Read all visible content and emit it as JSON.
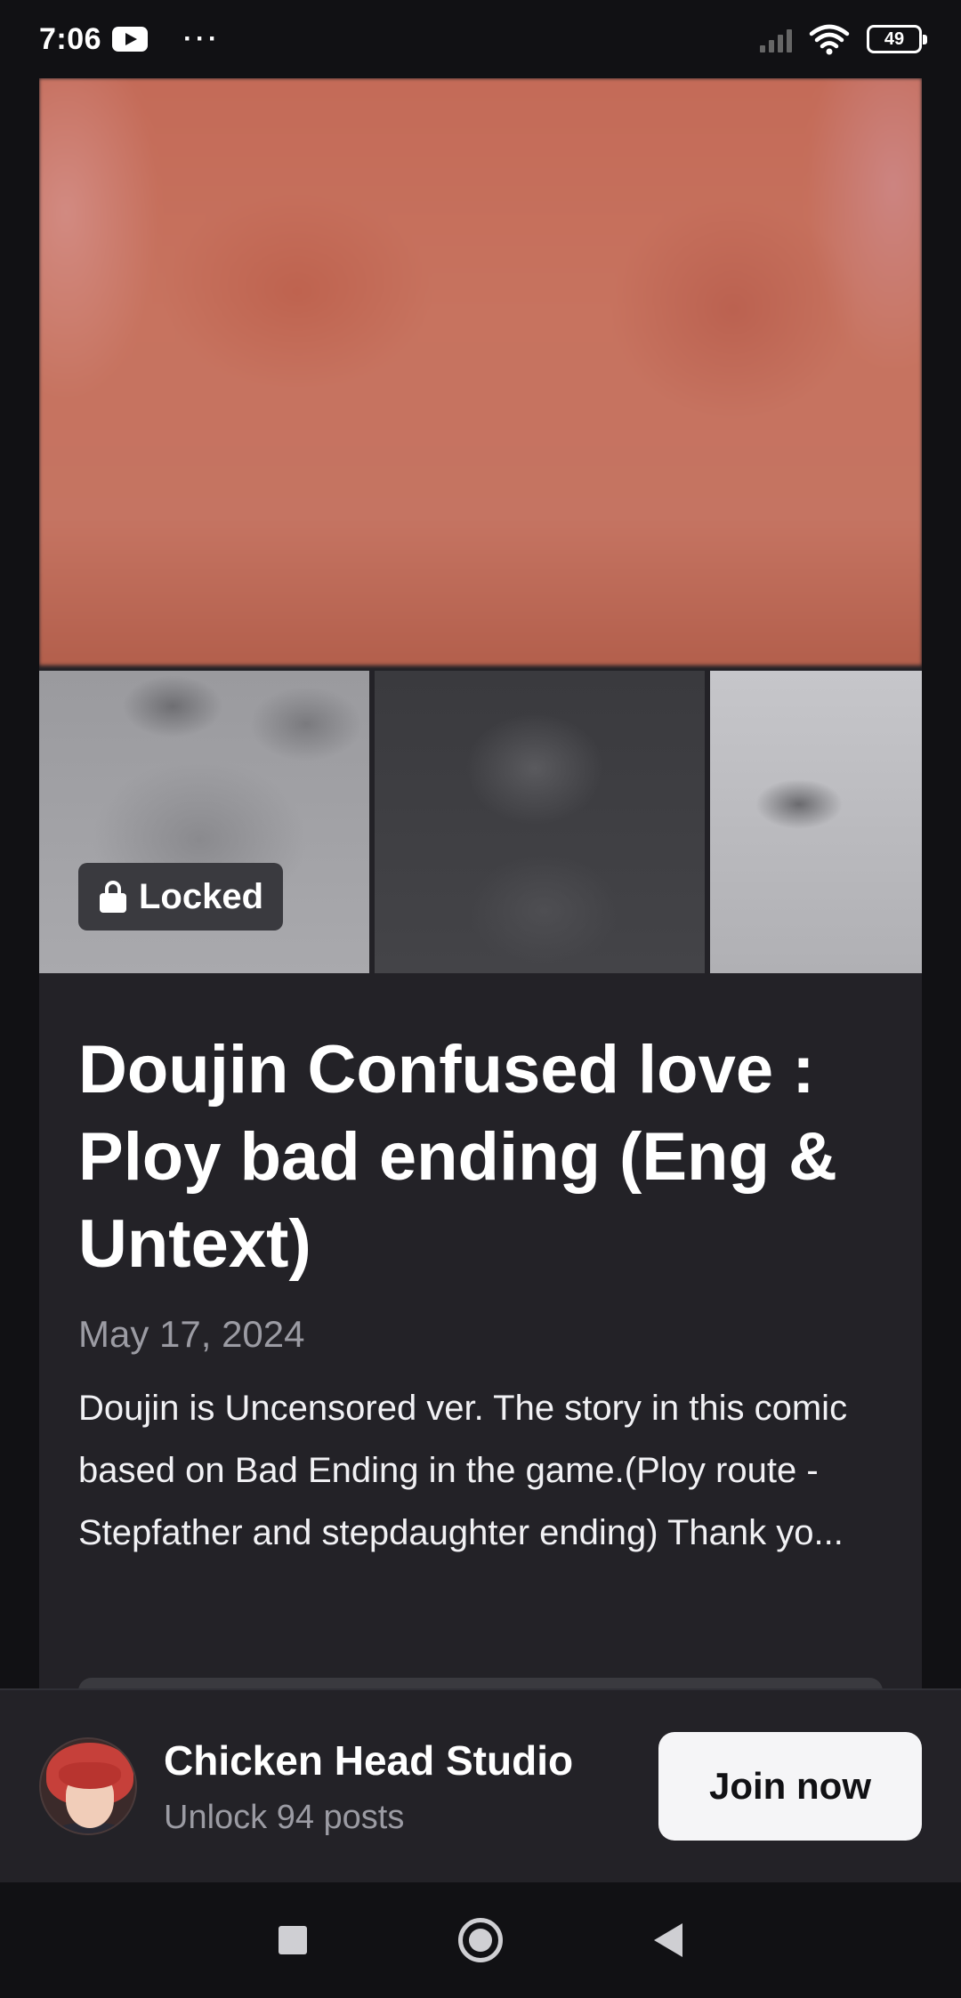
{
  "status_bar": {
    "time": "7:06",
    "more": "···",
    "battery": "49",
    "icons": [
      "youtube-icon",
      "more-dots-icon",
      "signal-icon",
      "wifi-icon",
      "battery-icon"
    ]
  },
  "post": {
    "locked_label": "Locked",
    "title": "Doujin Confused love : Ploy bad ending (Eng & Untext)",
    "date": "May 17, 2024",
    "excerpt": "Doujin is Uncensored ver. The story in this comic based on Bad Ending in the game.(Ploy route - Stepfather and stepdaughter ending) Thank yo..."
  },
  "creator": {
    "name": "Chicken Head Studio",
    "subtitle": "Unlock 94 posts",
    "join_label": "Join now"
  },
  "colors": {
    "background": "#111114",
    "card": "#232227",
    "muted_text": "#9b9ba3",
    "button_bg": "#f5f5f7"
  }
}
